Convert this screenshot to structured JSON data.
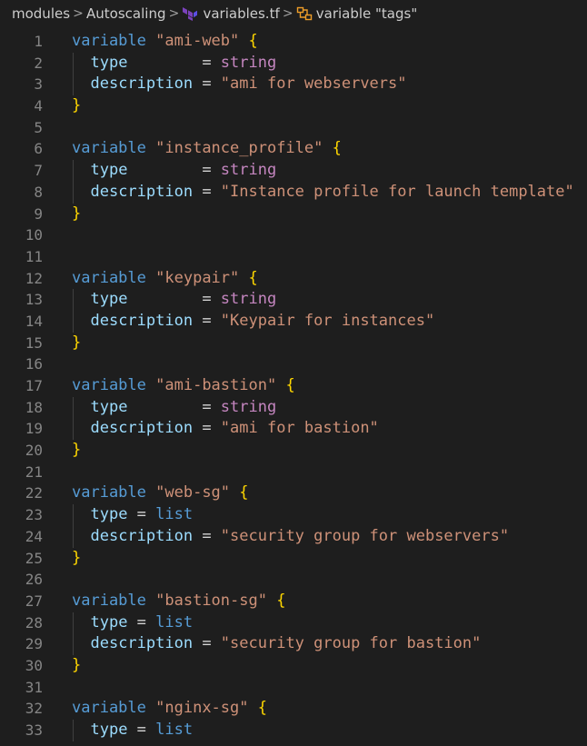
{
  "breadcrumb": {
    "items": [
      "modules",
      "Autoscaling",
      "variables.tf",
      "variable \"tags\""
    ],
    "separator": ">"
  },
  "colors": {
    "background": "#1e1e1e",
    "keyword": "#569cd6",
    "string": "#ce9178",
    "bracket": "#ffd700",
    "attribute": "#9cdcfe",
    "type_string": "#c586c0",
    "line_number": "#858585"
  },
  "icons": {
    "file": "terraform-icon",
    "symbol": "variable-symbol-icon"
  },
  "lines": [
    {
      "n": "1",
      "tokens": [
        [
          "kw",
          "variable"
        ],
        [
          "op",
          " "
        ],
        [
          "str",
          "\"ami-web\""
        ],
        [
          "op",
          " "
        ],
        [
          "br",
          "{"
        ]
      ]
    },
    {
      "n": "2",
      "guide": true,
      "tokens": [
        [
          "op",
          "  "
        ],
        [
          "attr",
          "type"
        ],
        [
          "op",
          "        = "
        ],
        [
          "tystr",
          "string"
        ]
      ]
    },
    {
      "n": "3",
      "guide": true,
      "tokens": [
        [
          "op",
          "  "
        ],
        [
          "attr",
          "description"
        ],
        [
          "op",
          " = "
        ],
        [
          "str",
          "\"ami for webservers\""
        ]
      ]
    },
    {
      "n": "4",
      "tokens": [
        [
          "br",
          "}"
        ]
      ]
    },
    {
      "n": "5",
      "tokens": []
    },
    {
      "n": "6",
      "tokens": [
        [
          "kw",
          "variable"
        ],
        [
          "op",
          " "
        ],
        [
          "str",
          "\"instance_profile\""
        ],
        [
          "op",
          " "
        ],
        [
          "br",
          "{"
        ]
      ]
    },
    {
      "n": "7",
      "guide": true,
      "tokens": [
        [
          "op",
          "  "
        ],
        [
          "attr",
          "type"
        ],
        [
          "op",
          "        = "
        ],
        [
          "tystr",
          "string"
        ]
      ]
    },
    {
      "n": "8",
      "guide": true,
      "tokens": [
        [
          "op",
          "  "
        ],
        [
          "attr",
          "description"
        ],
        [
          "op",
          " = "
        ],
        [
          "str",
          "\"Instance profile for launch template\""
        ]
      ]
    },
    {
      "n": "9",
      "tokens": [
        [
          "br",
          "}"
        ]
      ]
    },
    {
      "n": "10",
      "tokens": []
    },
    {
      "n": "11",
      "tokens": []
    },
    {
      "n": "12",
      "tokens": [
        [
          "kw",
          "variable"
        ],
        [
          "op",
          " "
        ],
        [
          "str",
          "\"keypair\""
        ],
        [
          "op",
          " "
        ],
        [
          "br",
          "{"
        ]
      ]
    },
    {
      "n": "13",
      "guide": true,
      "tokens": [
        [
          "op",
          "  "
        ],
        [
          "attr",
          "type"
        ],
        [
          "op",
          "        = "
        ],
        [
          "tystr",
          "string"
        ]
      ]
    },
    {
      "n": "14",
      "guide": true,
      "tokens": [
        [
          "op",
          "  "
        ],
        [
          "attr",
          "description"
        ],
        [
          "op",
          " = "
        ],
        [
          "str",
          "\"Keypair for instances\""
        ]
      ]
    },
    {
      "n": "15",
      "tokens": [
        [
          "br",
          "}"
        ]
      ]
    },
    {
      "n": "16",
      "tokens": []
    },
    {
      "n": "17",
      "tokens": [
        [
          "kw",
          "variable"
        ],
        [
          "op",
          " "
        ],
        [
          "str",
          "\"ami-bastion\""
        ],
        [
          "op",
          " "
        ],
        [
          "br",
          "{"
        ]
      ]
    },
    {
      "n": "18",
      "guide": true,
      "tokens": [
        [
          "op",
          "  "
        ],
        [
          "attr",
          "type"
        ],
        [
          "op",
          "        = "
        ],
        [
          "tystr",
          "string"
        ]
      ]
    },
    {
      "n": "19",
      "guide": true,
      "tokens": [
        [
          "op",
          "  "
        ],
        [
          "attr",
          "description"
        ],
        [
          "op",
          " = "
        ],
        [
          "str",
          "\"ami for bastion\""
        ]
      ]
    },
    {
      "n": "20",
      "tokens": [
        [
          "br",
          "}"
        ]
      ]
    },
    {
      "n": "21",
      "tokens": []
    },
    {
      "n": "22",
      "tokens": [
        [
          "kw",
          "variable"
        ],
        [
          "op",
          " "
        ],
        [
          "str",
          "\"web-sg\""
        ],
        [
          "op",
          " "
        ],
        [
          "br",
          "{"
        ]
      ]
    },
    {
      "n": "23",
      "guide": true,
      "tokens": [
        [
          "op",
          "  "
        ],
        [
          "attr",
          "type"
        ],
        [
          "op",
          " = "
        ],
        [
          "tylist",
          "list"
        ]
      ]
    },
    {
      "n": "24",
      "guide": true,
      "tokens": [
        [
          "op",
          "  "
        ],
        [
          "attr",
          "description"
        ],
        [
          "op",
          " = "
        ],
        [
          "str",
          "\"security group for webservers\""
        ]
      ]
    },
    {
      "n": "25",
      "tokens": [
        [
          "br",
          "}"
        ]
      ]
    },
    {
      "n": "26",
      "tokens": []
    },
    {
      "n": "27",
      "tokens": [
        [
          "kw",
          "variable"
        ],
        [
          "op",
          " "
        ],
        [
          "str",
          "\"bastion-sg\""
        ],
        [
          "op",
          " "
        ],
        [
          "br",
          "{"
        ]
      ]
    },
    {
      "n": "28",
      "guide": true,
      "tokens": [
        [
          "op",
          "  "
        ],
        [
          "attr",
          "type"
        ],
        [
          "op",
          " = "
        ],
        [
          "tylist",
          "list"
        ]
      ]
    },
    {
      "n": "29",
      "guide": true,
      "tokens": [
        [
          "op",
          "  "
        ],
        [
          "attr",
          "description"
        ],
        [
          "op",
          " = "
        ],
        [
          "str",
          "\"security group for bastion\""
        ]
      ]
    },
    {
      "n": "30",
      "tokens": [
        [
          "br",
          "}"
        ]
      ]
    },
    {
      "n": "31",
      "tokens": []
    },
    {
      "n": "32",
      "tokens": [
        [
          "kw",
          "variable"
        ],
        [
          "op",
          " "
        ],
        [
          "str",
          "\"nginx-sg\""
        ],
        [
          "op",
          " "
        ],
        [
          "br",
          "{"
        ]
      ]
    },
    {
      "n": "33",
      "guide": true,
      "tokens": [
        [
          "op",
          "  "
        ],
        [
          "attr",
          "type"
        ],
        [
          "op",
          " = "
        ],
        [
          "tylist",
          "list"
        ]
      ]
    }
  ]
}
